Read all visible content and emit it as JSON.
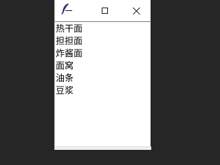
{
  "window": {
    "min_label": "—",
    "icon": "feather-icon",
    "max_icon": "maximize-icon",
    "close_icon": "close-icon"
  },
  "list": {
    "items": [
      {
        "label": "热干面"
      },
      {
        "label": "担担面"
      },
      {
        "label": "炸酱面"
      },
      {
        "label": "面窝"
      },
      {
        "label": "油条"
      },
      {
        "label": "豆浆"
      }
    ]
  }
}
